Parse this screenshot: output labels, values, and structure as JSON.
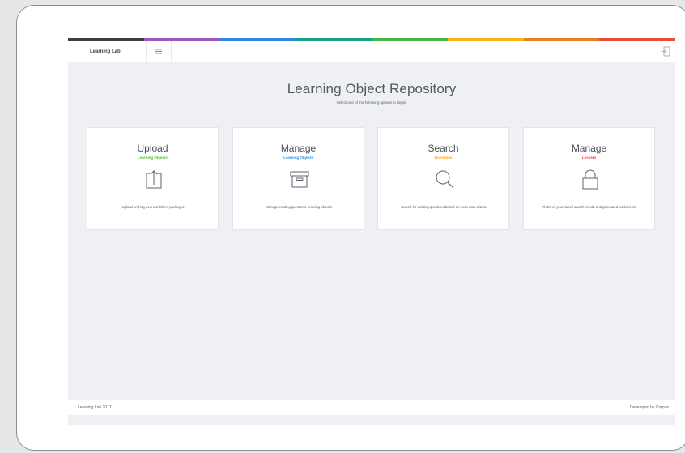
{
  "header": {
    "brand": "Learning Lab",
    "menu_icon": "hamburger-menu-icon",
    "signout_icon": "sign-out-icon"
  },
  "color_strip": [
    "#3b4046",
    "#9b59b6",
    "#2e86de",
    "#16a085",
    "#43b64a",
    "#f5b41a",
    "#e67e22",
    "#e74c3c"
  ],
  "hero": {
    "title": "Learning Object Repository",
    "subtitle": "Select one of the following options to begin."
  },
  "cards": [
    {
      "title": "Upload",
      "subtitle": "Learning Objects",
      "subtitle_color": "#5cb63f",
      "icon": "upload-icon",
      "description": "Upload and tag new worksheet packages."
    },
    {
      "title": "Manage",
      "subtitle": "Learning Objects",
      "subtitle_color": "#3a8fd6",
      "icon": "archive-box-icon",
      "description": "Manage existing questions, learning objects."
    },
    {
      "title": "Search",
      "subtitle": "Questions",
      "subtitle_color": "#f2a61c",
      "icon": "search-icon",
      "description": "Search for existing questions based on meta data criteria."
    },
    {
      "title": "Manage",
      "subtitle": "Lockers",
      "subtitle_color": "#e2413b",
      "icon": "lock-icon",
      "description": "Retrieve your saved search results and generated worksheets."
    }
  ],
  "footer": {
    "left": "Learning Lab 2017",
    "right": "Developed by Corpus"
  }
}
